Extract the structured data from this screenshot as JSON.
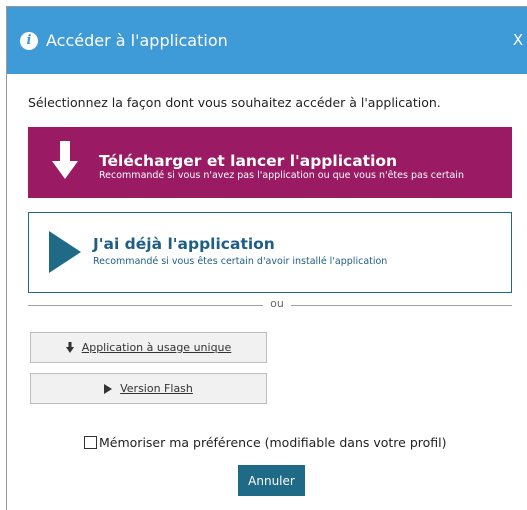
{
  "dialog": {
    "title": "Accéder à l'application",
    "close_label": "X",
    "prompt": "Sélectionnez la façon dont vous souhaitez accéder à l'application."
  },
  "options": {
    "download": {
      "title": "Télécharger et lancer l'application",
      "subtitle": "Recommandé si vous n'avez pas l'application ou que vous n'êtes pas certain"
    },
    "have_app": {
      "title": "J'ai déjà l'application",
      "subtitle": "Recommandé si vous êtes certain d'avoir installé l'application"
    }
  },
  "separator": {
    "label": "ou"
  },
  "alternatives": {
    "single_use": "Application à usage unique",
    "flash": "Version Flash"
  },
  "remember": {
    "label": "Mémoriser ma préférence (modifiable dans votre profil)",
    "checked": false
  },
  "cancel_label": "Annuler",
  "colors": {
    "titlebar": "#3f9ad8",
    "download_bg": "#9a1a63",
    "primary": "#1f6a86"
  },
  "icons": {
    "title": "info-icon",
    "download": "arrow-down-icon",
    "have_app": "play-icon",
    "single_use": "arrow-down-icon",
    "flash": "play-icon"
  }
}
